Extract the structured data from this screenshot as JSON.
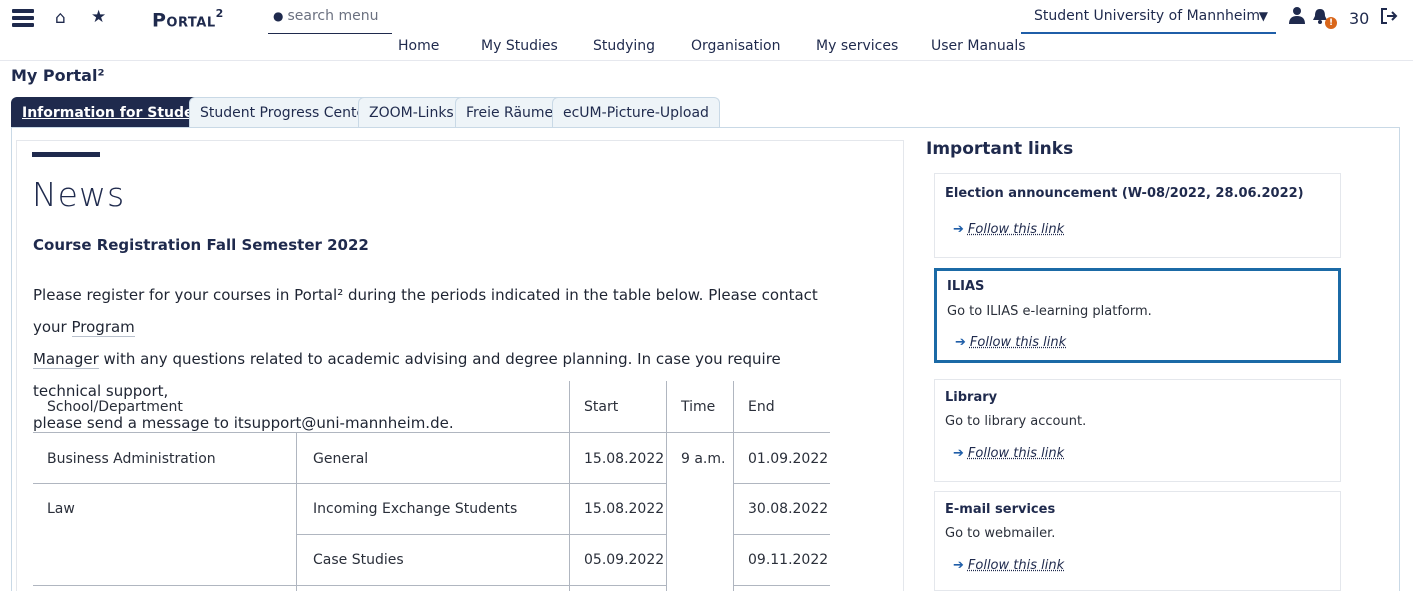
{
  "header": {
    "logo": "Portal",
    "logo_sup": "2",
    "search_placeholder": "search menu",
    "university": "Student University of Mannheim",
    "notification_badge": "!",
    "count": "30",
    "icons": [
      "menu-icon",
      "home-icon",
      "star-icon",
      "user-icon",
      "bell-icon",
      "logout-icon"
    ]
  },
  "nav": [
    "Home",
    "My Studies",
    "Studying",
    "Organisation",
    "My services",
    "User Manuals"
  ],
  "page_title": "My Portal²",
  "tabs": [
    "Information for Students",
    "Student Progress Center",
    "ZOOM-Links",
    "Freie Räume",
    "ecUM-Picture-Upload"
  ],
  "news": {
    "heading": "News",
    "subheading": "Course Registration Fall Semester 2022",
    "p1": "Please register for your courses in Portal² during the periods indicated in the table below. Please contact your ",
    "link1a": "Program",
    "link1b": "Manager",
    "p2": " with any questions related to academic advising and degree planning. In case you require technical support,",
    "p3": "please send a message to ",
    "email": "itsupport@uni-mannheim.de",
    "p3_end": ".",
    "table": {
      "headers": [
        "School/Department",
        "Start",
        "Time",
        "End"
      ],
      "rows": [
        [
          "Business Administration",
          "General",
          "15.08.2022",
          "9 a.m.",
          "01.09.2022"
        ],
        [
          "Law",
          "Incoming Exchange Students",
          "15.08.2022",
          "",
          "30.08.2022"
        ],
        [
          "",
          "Case Studies",
          "05.09.2022",
          "",
          "09.11.2022"
        ]
      ]
    }
  },
  "important_links": {
    "heading": "Important links",
    "cards": [
      {
        "title": "Election announcement (W-08/2022, 28.06.2022)",
        "desc": "",
        "link": "Follow this link"
      },
      {
        "title": "ILIAS",
        "desc": "Go to ILIAS e-learning platform.",
        "link": "Follow this link"
      },
      {
        "title": "Library",
        "desc": "Go to library account.",
        "link": "Follow this link"
      },
      {
        "title": "E-mail services",
        "desc": "Go to webmailer.",
        "link": "Follow this link"
      }
    ]
  },
  "colors": {
    "primary": "#1f2a4d",
    "accent": "#1b6aa6",
    "badge": "#d9661a"
  }
}
